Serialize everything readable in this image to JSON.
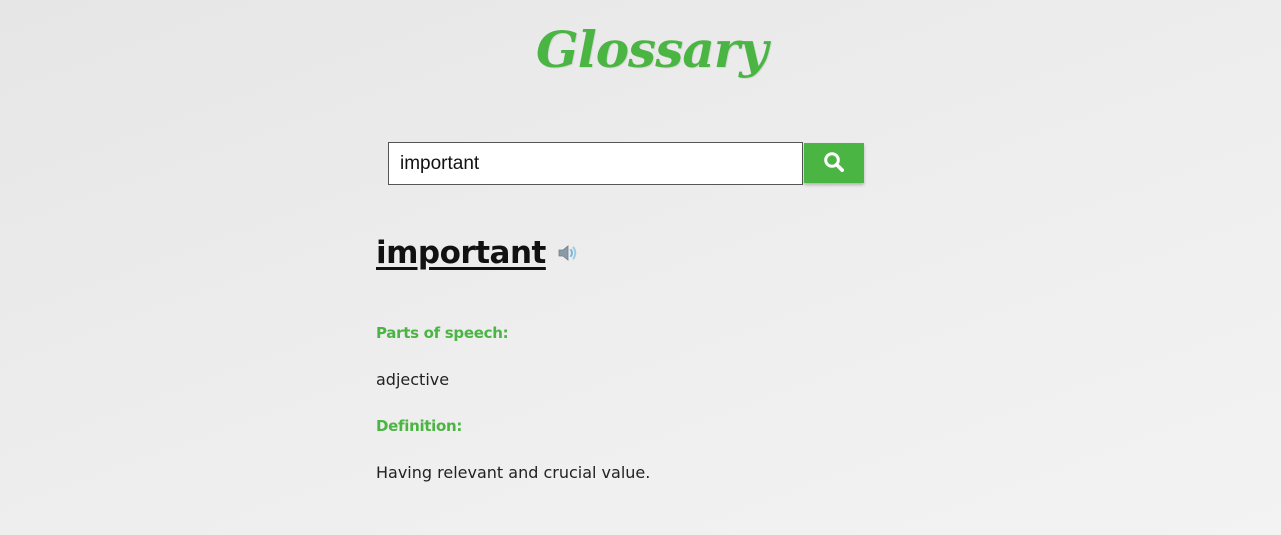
{
  "header": {
    "logo_text": "Glossary"
  },
  "search": {
    "value": "important",
    "button_icon": "search-icon"
  },
  "entry": {
    "word": "important",
    "speaker_icon": "speaker-icon",
    "parts_of_speech_label": "Parts of speech:",
    "parts_of_speech_value": "adjective",
    "definition_label": "Definition:",
    "definition_value": "Having relevant and crucial value."
  },
  "colors": {
    "accent": "#4bb543",
    "text": "#111111",
    "background": "#ececec"
  }
}
